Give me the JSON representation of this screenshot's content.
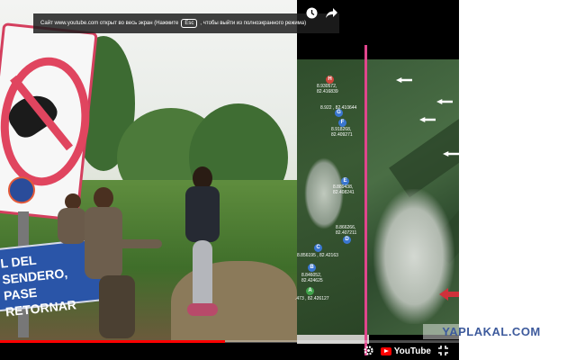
{
  "player": {
    "fullscreen_notice": {
      "text_before": "Сайт www.youtube.com открыт во весь экран (Нажмите",
      "key": "Esc",
      "text_after": ", чтобы выйти из полноэкранного режима)"
    },
    "top_icons": [
      "clock-icon",
      "share-icon"
    ],
    "progress_percent": 49,
    "brand": "YouTube",
    "icons": [
      "settings-icon",
      "fullscreen-exit-icon"
    ],
    "colors": {
      "progress": "#ff0000",
      "brand": "#ff0000"
    }
  },
  "video": {
    "sign_lines": [
      "L DEL SENDERO,",
      "PASE RETORNAR"
    ],
    "map_markers": [
      {
        "label": "H",
        "color": "#d0453a",
        "coords": [
          "8.930572,",
          "82.416839"
        ]
      },
      {
        "label": "G",
        "color": "#3a76d0",
        "coords": [
          "8.922 , 82.410644"
        ]
      },
      {
        "label": "F",
        "color": "#3a76d0",
        "coords": [
          "8.918268,",
          "82.409271"
        ]
      },
      {
        "label": "E",
        "color": "#3a76d0",
        "coords": [
          "8.889438,",
          "82.408241"
        ]
      },
      {
        "label": "D",
        "color": "#3a76d0",
        "coords": [
          "8.866266,",
          "82.407211"
        ]
      },
      {
        "label": "C",
        "color": "#3a76d0",
        "coords": [
          "8.856195 , 82.42163"
        ]
      },
      {
        "label": "B",
        "color": "#3a76d0",
        "coords": [
          "8.846052,",
          "82.424625"
        ]
      },
      {
        "label": "A",
        "color": "#3fa34a",
        "coords": [
          ".473 , 82.426127"
        ]
      }
    ]
  },
  "watermark": "YAPLAKAL.COM"
}
